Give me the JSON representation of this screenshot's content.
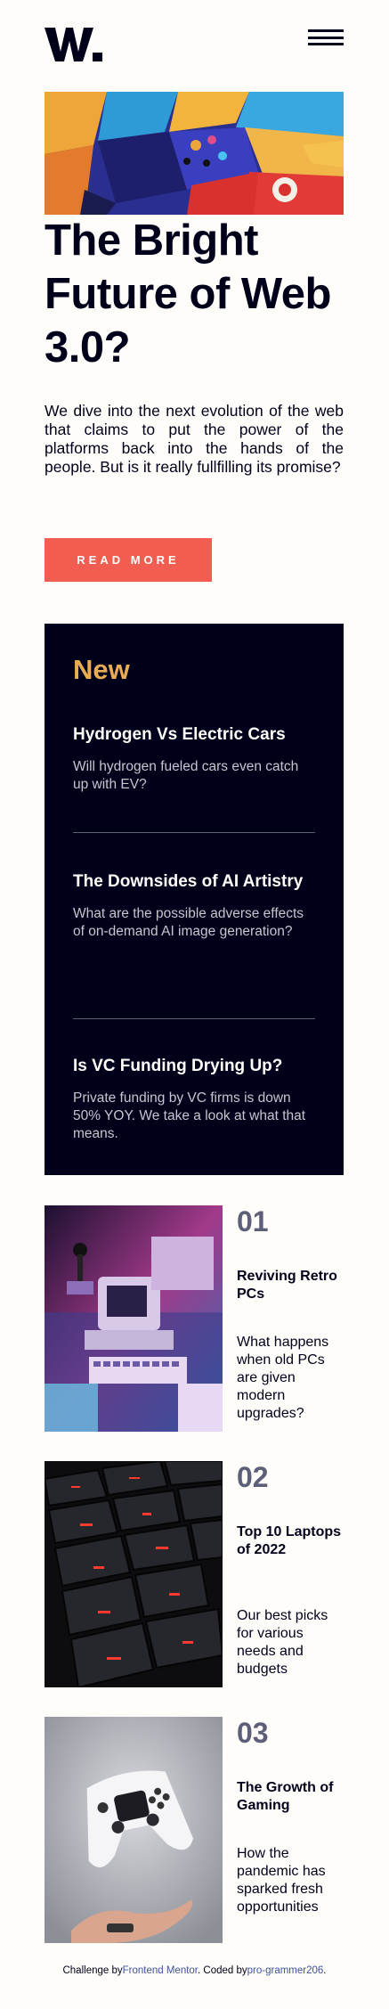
{
  "header": {
    "logo_text": "W.",
    "menu_icon": "hamburger-menu-icon"
  },
  "hero": {
    "title": "The Bright Future of Web 3.0?",
    "description": "We dive into the next evolution of the web that claims to put the power of the platforms back into the hands of the people. But is it really fullfilling its promise?",
    "button_label": "READ MORE"
  },
  "new_panel": {
    "heading": "New",
    "items": [
      {
        "title": "Hydrogen Vs Electric Cars",
        "text": "Will hydrogen fueled cars even catch up with EV?"
      },
      {
        "title": "The Downsides of AI Artistry",
        "text": "What are the possible adverse effects of on-demand AI image generation?"
      },
      {
        "title": "Is VC Funding Drying Up?",
        "text": "Private funding by VC firms is down 50% YOY. We take a look at what that means."
      }
    ]
  },
  "cards": [
    {
      "number": "01",
      "title": "Reviving Retro PCs",
      "text": "What happens when old PCs are given modern upgrades?"
    },
    {
      "number": "02",
      "title": "Top 10 Laptops of 2022",
      "text": "Our best picks for various needs and budgets"
    },
    {
      "number": "03",
      "title": "The Growth of Gaming",
      "text": "How the pandemic has sparked fresh opportunities"
    }
  ],
  "footer": {
    "prefix": "Challenge by",
    "link1": "Frontend Mentor",
    "middle": ". Coded by",
    "link2": "pro-grammer206",
    "suffix": "."
  },
  "colors": {
    "accent": "#f15d51",
    "panel_bg": "#00001a",
    "new_heading": "#e9ab53",
    "number_gray": "#5d5f79",
    "link": "#3e52a3"
  }
}
